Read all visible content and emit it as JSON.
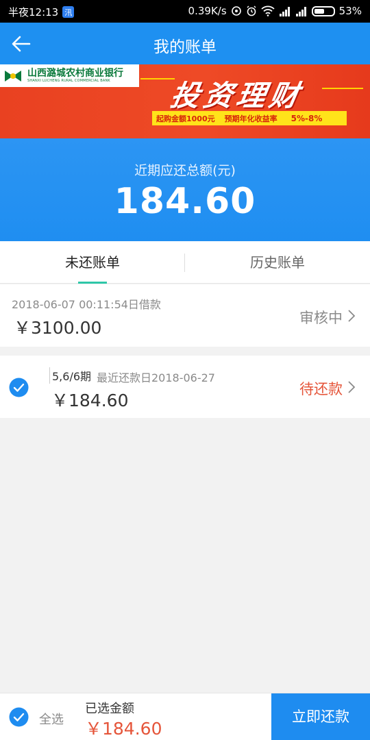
{
  "status_bar": {
    "time": "半夜12:13",
    "app_badge": "汛",
    "network_speed": "0.39K/s",
    "battery": "53%",
    "battery_level": 0.53
  },
  "header": {
    "title": "我的账单"
  },
  "banner": {
    "bank_name": "山西潞城农村商业银行",
    "bank_name_en": "SHANXI LUCHENG RURAL COMMERCIAL BANK",
    "slogan": "投资理财",
    "min_amount": "起购金额1000元",
    "rate_label": "预期年化收益率",
    "rate_value": "5%-8%"
  },
  "summary": {
    "label": "近期应还总额(元)",
    "amount": "184.60"
  },
  "tabs": [
    {
      "label": "未还账单",
      "active": true
    },
    {
      "label": "历史账单",
      "active": false
    }
  ],
  "bills": [
    {
      "date": "2018-06-07 00:11:54日借款",
      "amount": "￥3100.00",
      "status": "审核中"
    },
    {
      "period": "5,6/6期",
      "recent_date": "最近还款日2018-06-27",
      "amount": "￥184.60",
      "status": "待还款",
      "checked": true
    }
  ],
  "bottom_bar": {
    "select_all": "全选",
    "selected_label": "已选金额",
    "selected_amount": "￥184.60",
    "pay_button": "立即还款"
  },
  "colors": {
    "primary_blue": "#1e90f1",
    "accent_green": "#2ec7a8",
    "warning_red": "#e5553a",
    "banner_red": "#e94121",
    "banner_yellow": "#ffe31a"
  }
}
